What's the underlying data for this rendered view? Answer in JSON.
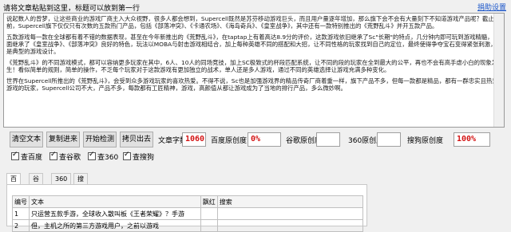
{
  "header": {
    "hint": "请将文章粘贴到这里，标题可以放到第一行",
    "donate_link": "捐助设置"
  },
  "article": {
    "paragraphs": [
      "说起数人的曾梦，让这些商业的游戏厂商主入大众视野，很多人都会想到，Supercell既然是苏芬移动游戏巨头，而且用户量逐年增加，那么旗下会不会有大量刻下不知道游戏产品呢？截止目前，Supercell旗下仅仅只有次数的五款热门产品，包括《部落冲突》、《卡通农场》、《海岛奇兵》、《皇室战争》，其中还有一款特别推出的《荒野乱斗》并开五款产品。",
      "五款游戏每一款在全球都有着不错的数据表现，甚至在今年新推出的《荒野乱斗》，在taptap上有着高达8.9分的评价，这款游戏依旧继承了Sc\"长期\"的特点，几分钟内即可玩到游戏精髓，画面继承了《皇室战争》、《部落冲突》良好的特色，玩法以MOBA与射击游戏相结合，加上每种英雄不同的搭配和大招，让不同性格的玩家找到自己的定位，最终使得争夺宝石变得紧张刺激，是典型的游戏设计。",
      "《荒野乱斗》的不同游戏模式，都可以容纳更多玩家在其中，6人、10人的同场竞技，加上SC极致式的杯段匹配系统，让不同的段的玩家在全到最大的公平，再也不会有高手虐小白的现象发生！看似简单的规则，简单的操作，不乏每个玩家对于这款游戏有更加独立的战术，单人还是多人游戏，通过不同的英雄选择让游戏充满多种变化。",
      "世界在Supercell所推出的《荒野乱斗》，会受到众多游戏玩家的喜欢热爱。不得不说，Sc也是加强游戏界的精品传奇厂商着重一样，旗下产品不多，但每一款都是精品，都有一群忠实且热爱游戏的玩家，Supercell公司不大，产品不多，每款都有工匠精神，游戏，高颜值从都让游戏成为了当地的排行产品，多么微妙啊。"
    ]
  },
  "toolbar": {
    "clear_label": "清空文本",
    "copy_label": "复制进来",
    "check_label": "开始检测",
    "copy_out_label": "拷贝出去",
    "word_count_label": "文章字数",
    "word_count_value": "1060",
    "baidu_label": "百度原创度",
    "baidu_value": "0%",
    "google_label": "谷歌原创度",
    "google_value": "",
    "s360_label": "360原创度",
    "s360_value": "",
    "sogou_label": "搜狗原创度",
    "sogou_value": "100%"
  },
  "checkboxes": [
    {
      "label": "查百度",
      "checked": true
    },
    {
      "label": "查谷歌",
      "checked": true
    },
    {
      "label": "查360",
      "checked": true
    },
    {
      "label": "查搜狗",
      "checked": true
    }
  ],
  "tabs": [
    "百度",
    "谷歌",
    "360",
    "搜狗"
  ],
  "results_table": {
    "columns": [
      "编号",
      "文本",
      "飘红",
      "搜索"
    ],
    "rows": [
      [
        "1",
        "只运营五款手游，全球收入散叫板《王者荣耀》？手游",
        "",
        ""
      ],
      [
        "2",
        "但，主机之所的第三方游戏用户，之前以游戏",
        "",
        ""
      ]
    ]
  }
}
